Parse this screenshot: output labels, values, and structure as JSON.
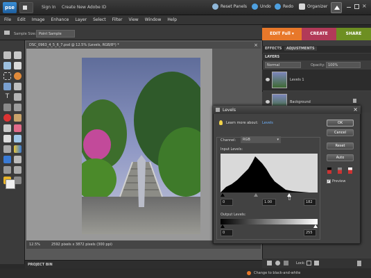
{
  "app": {
    "logo": "pse",
    "sign_in": "Sign In",
    "create_id": "Create New Adobe ID",
    "reset_panels": "Reset Panels",
    "undo": "Undo",
    "redo": "Redo",
    "organizer": "Organizer"
  },
  "menu": [
    "File",
    "Edit",
    "Image",
    "Enhance",
    "Layer",
    "Select",
    "Filter",
    "View",
    "Window",
    "Help"
  ],
  "options": {
    "sample_size_label": "Sample Size:",
    "sample_size_value": "Point Sample"
  },
  "modes": {
    "edit": "EDIT Full",
    "create": "CREATE",
    "share": "SHARE"
  },
  "document": {
    "title": "DSC_0963_4_5_6_7.psd @ 12.5% (Levels, RGB/8*) *",
    "zoom": "12.5%",
    "info": "2592 pixels x 3872 pixels (300 ppi)"
  },
  "panels": {
    "effects_tab": "EFFECTS",
    "adjustments_tab": "ADJUSTMENTS",
    "layers_header": "LAYERS",
    "blend_mode": "Normal",
    "opacity_label": "Opacity:",
    "opacity_value": "100%",
    "lock_label": "Lock:",
    "layers": [
      {
        "name": "Levels 1"
      },
      {
        "name": "Background"
      }
    ]
  },
  "project_bin": "PROJECT BIN",
  "hint": "Change to black-and-white",
  "levels": {
    "title": "Levels",
    "learn_more": "Learn more about:",
    "learn_link": "Levels",
    "channel_label": "Channel:",
    "channel_value": "RGB",
    "input_label": "Input Levels:",
    "input_black": "0",
    "input_gamma": "1.00",
    "input_white": "182",
    "output_label": "Output Levels:",
    "output_black": "0",
    "output_white": "255",
    "ok": "OK",
    "cancel": "Cancel",
    "reset": "Reset",
    "auto": "Auto",
    "preview": "Preview"
  },
  "colors": {
    "edit_tab": "#e8782a",
    "create_tab": "#b23a58",
    "share_tab": "#7a9a2a",
    "link": "#6fb3ff"
  }
}
